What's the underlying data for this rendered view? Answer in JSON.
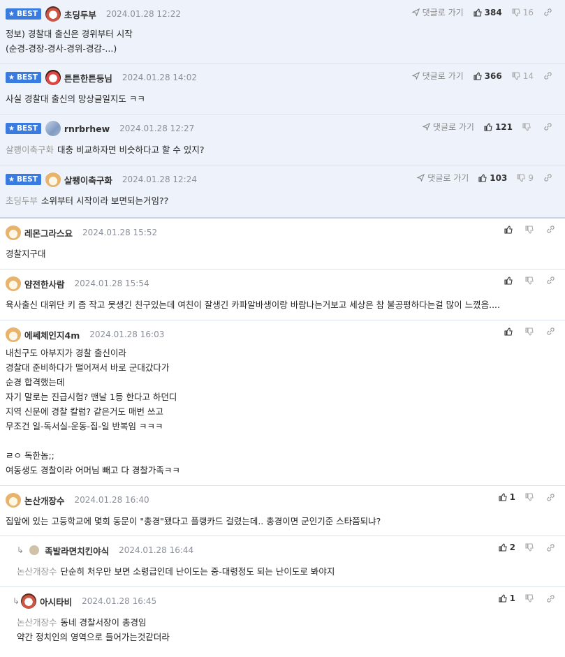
{
  "best_label": "BEST",
  "reply_label": "댓글로 가기",
  "comments": [
    {
      "nick": "초딩두부",
      "date": "2024.01.28 12:22",
      "up": "384",
      "down": "16",
      "mention": "",
      "text": "정보) 경찰대 출신은 경위부터 시작\n(순경-경장-경사-경위-경감-...)",
      "avatar": "a1"
    },
    {
      "nick": "튼튼한튼둥님",
      "date": "2024.01.28 14:02",
      "up": "366",
      "down": "14",
      "mention": "",
      "text": "사실 경찰대 출신의 망상글일지도 ㅋㅋ",
      "avatar": "a2"
    },
    {
      "nick": "rnrbrhew",
      "date": "2024.01.28 12:27",
      "up": "121",
      "down": "",
      "mention": "살쾡이축구화",
      "text": "대충 비교하자면 비슷하다고 할 수 있지?",
      "avatar": "a3"
    },
    {
      "nick": "살쾡이축구화",
      "date": "2024.01.28 12:24",
      "up": "103",
      "down": "9",
      "mention": "초딩두부",
      "text": "소위부터 시작이라 보면되는거임??",
      "avatar": "dog"
    },
    {
      "nick": "레몬그라스요",
      "date": "2024.01.28 15:52",
      "up": "",
      "down": "",
      "mention": "",
      "text": "경찰지구대",
      "avatar": "dog"
    },
    {
      "nick": "얌전한사람",
      "date": "2024.01.28 15:54",
      "up": "",
      "down": "",
      "mention": "",
      "text": "육사출신 대위단 키 좀 작고 못생긴 친구있는데 여친이 잘생긴 카파알바생이랑 바람나는거보고 세상은 참 불공평하다는걸 많이 느꼈음....",
      "avatar": "dog"
    },
    {
      "nick": "에쎄체인지4m",
      "date": "2024.01.28 16:03",
      "up": "",
      "down": "",
      "mention": "",
      "text": "내친구도 아부지가 경찰 출신이라\n경찰대 준비하다가 떨어져서 바로 군대갔다가\n순경 합격했는데\n자기 말로는 진급시험? 맨날 1등 한다고 하던디\n지역 신문에 경찰 칼럼? 같은거도 매번 쓰고\n무조건 일-독서실-운동-집-일 반복임 ㅋㅋㅋ\n\nㄹㅇ 독한놈;;\n여동생도 경찰이라 어머님 빼고 다 경찰가족ㅋㅋ",
      "avatar": "dog"
    },
    {
      "nick": "논산개장수",
      "date": "2024.01.28 16:40",
      "up": "1",
      "down": "",
      "mention": "",
      "text": "집앞에 있는 고등학교에 몇회 동문이 \"총경\"됐다고 플랭카드 걸렸는데.. 총경이면 군인기준 스타쯤되냐?",
      "avatar": "dog"
    },
    {
      "nick": "족발라면치킨야식",
      "date": "2024.01.28 16:44",
      "up": "2",
      "down": "",
      "mention": "논산개장수",
      "text": "단순히 처우만 보면 소령급인데 난이도는 중-대령정도 되는 난이도로 봐야지",
      "avatar": "small"
    },
    {
      "nick": "아시타비",
      "date": "2024.01.28 16:45",
      "up": "1",
      "down": "",
      "mention": "논산개장수",
      "text": "동네 경찰서장이 총경임\n약간 정치인의 영역으로 들어가는것같더라",
      "avatar": "a1"
    }
  ]
}
